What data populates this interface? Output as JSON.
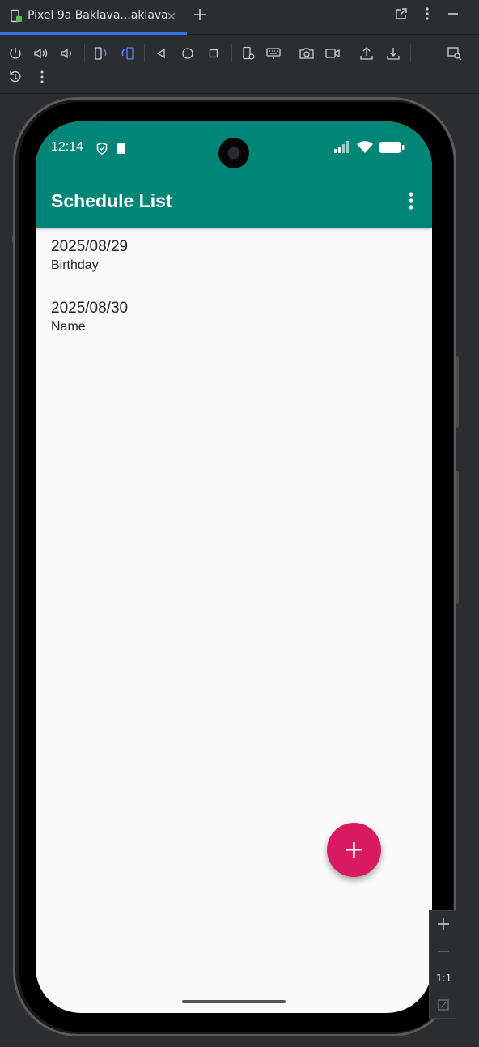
{
  "window": {
    "tab_title": "Pixel 9a Baklava...aklava"
  },
  "toolbar": {
    "icons": [
      "power-icon",
      "volume-up-icon",
      "volume-down-icon",
      "rotate-left-icon",
      "rotate-right-icon",
      "back-icon",
      "home-icon",
      "overview-icon",
      "device-settings-icon",
      "keyboard-icon",
      "screenshot-icon",
      "record-icon",
      "upload-icon",
      "download-icon",
      "inspect-icon",
      "reset-icon",
      "more-icon"
    ]
  },
  "phone": {
    "status_bar": {
      "time": "12:14"
    },
    "app_bar": {
      "title": "Schedule List",
      "color": "#008577"
    },
    "schedule_items": [
      {
        "date": "2025/08/29",
        "name": "Birthday"
      },
      {
        "date": "2025/08/30",
        "name": "Name"
      }
    ],
    "fab": {
      "label": "+",
      "color": "#d81b60"
    }
  },
  "zoom": {
    "reset_label": "1:1"
  }
}
